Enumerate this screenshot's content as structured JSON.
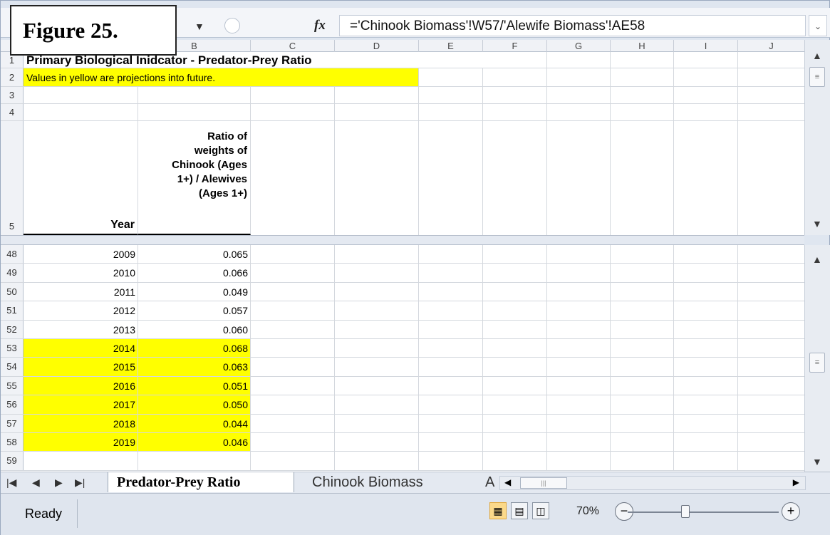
{
  "figure_label": "Figure 25.",
  "formula_bar": {
    "fx_label": "fx",
    "formula": "='Chinook Biomass'!W57/'Alewife Biomass'!AE58"
  },
  "column_headers": [
    "B",
    "C",
    "D",
    "E",
    "F",
    "G",
    "H",
    "I",
    "J"
  ],
  "top_rows": {
    "r1": {
      "num": "1",
      "text": "Primary Biological Inidcator - Predator-Prey Ratio"
    },
    "r2": {
      "num": "2",
      "text": "Values in yellow are projections into future."
    },
    "r3": {
      "num": "3"
    },
    "r4": {
      "num": "4"
    },
    "r5": {
      "num": "5",
      "year_header": "Year",
      "ratio_header": [
        "Ratio of",
        "weights of",
        "Chinook (Ages",
        "1+) / Alewives",
        "(Ages 1+)"
      ]
    }
  },
  "data_rows": [
    {
      "num": "48",
      "year": "2009",
      "ratio": "0.065",
      "projected": false
    },
    {
      "num": "49",
      "year": "2010",
      "ratio": "0.066",
      "projected": false
    },
    {
      "num": "50",
      "year": "2011",
      "ratio": "0.049",
      "projected": false
    },
    {
      "num": "51",
      "year": "2012",
      "ratio": "0.057",
      "projected": false
    },
    {
      "num": "52",
      "year": "2013",
      "ratio": "0.060",
      "projected": false
    },
    {
      "num": "53",
      "year": "2014",
      "ratio": "0.068",
      "projected": true
    },
    {
      "num": "54",
      "year": "2015",
      "ratio": "0.063",
      "projected": true
    },
    {
      "num": "55",
      "year": "2016",
      "ratio": "0.051",
      "projected": true
    },
    {
      "num": "56",
      "year": "2017",
      "ratio": "0.050",
      "projected": true
    },
    {
      "num": "57",
      "year": "2018",
      "ratio": "0.044",
      "projected": true
    },
    {
      "num": "58",
      "year": "2019",
      "ratio": "0.046",
      "projected": true
    },
    {
      "num": "59",
      "year": "",
      "ratio": "",
      "projected": false
    }
  ],
  "projection_color": "#ffff00",
  "tabs": {
    "active": "Predator-Prey Ratio",
    "other": "Chinook Biomass",
    "partial": "A"
  },
  "status": {
    "ready": "Ready",
    "zoom": "70%"
  }
}
